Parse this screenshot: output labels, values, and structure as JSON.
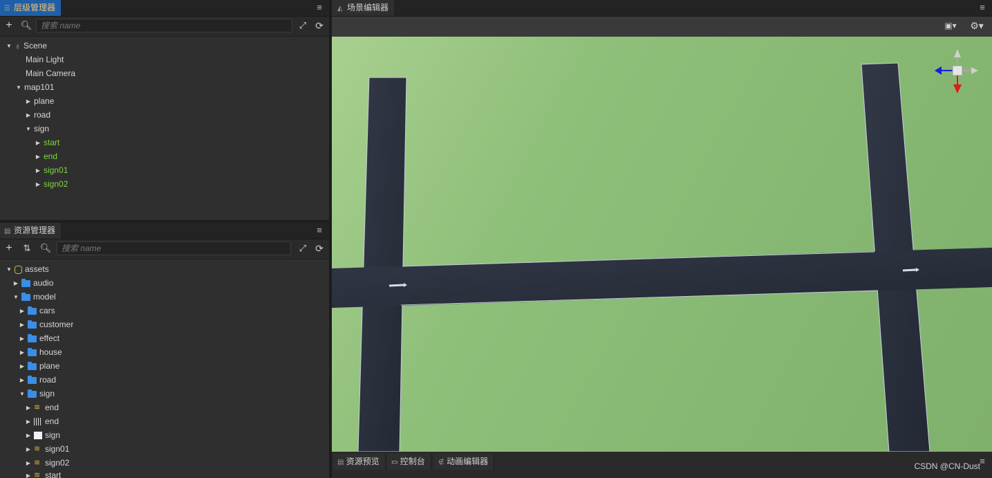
{
  "hierarchy": {
    "title": "层级管理器",
    "search_placeholder": "搜索 name",
    "nodes": [
      {
        "label": "Scene"
      },
      {
        "label": "Main Light"
      },
      {
        "label": "Main Camera"
      },
      {
        "label": "map101"
      },
      {
        "label": "plane"
      },
      {
        "label": "road"
      },
      {
        "label": "sign"
      },
      {
        "label": "start"
      },
      {
        "label": "end"
      },
      {
        "label": "sign01"
      },
      {
        "label": "sign02"
      }
    ]
  },
  "assets": {
    "title": "资源管理器",
    "search_placeholder": "搜索 name",
    "nodes": [
      {
        "label": "assets"
      },
      {
        "label": "audio"
      },
      {
        "label": "model"
      },
      {
        "label": "cars"
      },
      {
        "label": "customer"
      },
      {
        "label": "effect"
      },
      {
        "label": "house"
      },
      {
        "label": "plane"
      },
      {
        "label": "road"
      },
      {
        "label": "sign"
      },
      {
        "label": "end"
      },
      {
        "label": "end"
      },
      {
        "label": "sign"
      },
      {
        "label": "sign01"
      },
      {
        "label": "sign02"
      },
      {
        "label": "start"
      }
    ]
  },
  "scene": {
    "title": "场景编辑器",
    "colors": {
      "grass": "#8fc07a",
      "road": "#262b36",
      "axis_x": "#1a1ae0",
      "axis_y": "#e01a1a"
    }
  },
  "bottom": {
    "tabs": [
      "资源预览",
      "控制台",
      "动画编辑器"
    ]
  },
  "watermark": "CSDN @CN-Dust"
}
